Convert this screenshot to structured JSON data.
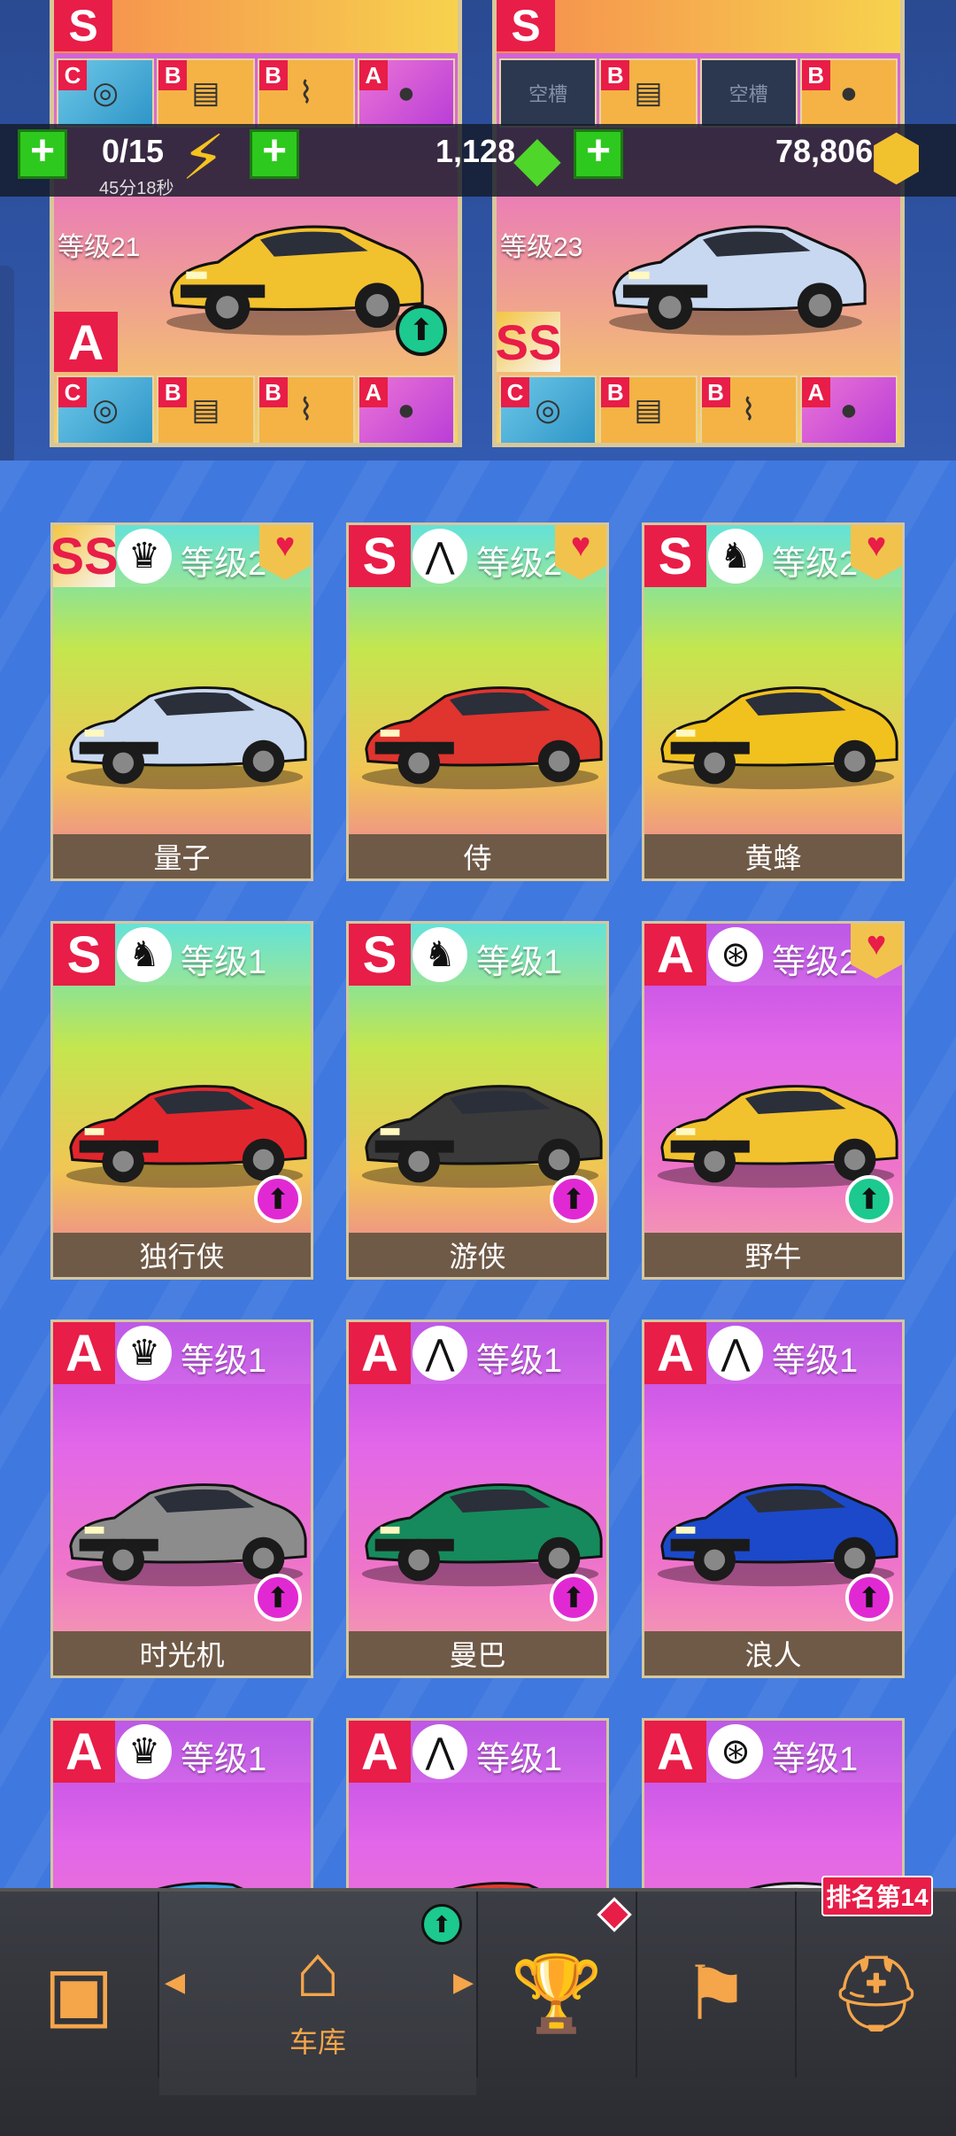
{
  "resources": {
    "energy": {
      "value": "0/15",
      "timer": "45分18秒",
      "icon": "lightning-bolt-icon"
    },
    "gems": {
      "value": "1,128",
      "icon": "green-gem-icon"
    },
    "coins": {
      "value": "78,806",
      "icon": "gold-hex-coin-icon"
    }
  },
  "featured_cars": [
    {
      "level": "等级21",
      "rank_top": "S",
      "rank": "A",
      "parts": [
        {
          "rank": "C",
          "icon": "turbo-icon"
        },
        {
          "rank": "B",
          "icon": "ecu-icon"
        },
        {
          "rank": "B",
          "icon": "shock-absorber-icon"
        },
        {
          "rank": "A",
          "icon": "tire-icon"
        }
      ],
      "parts_top": [
        {
          "rank": "C",
          "icon": "turbo-icon"
        },
        {
          "rank": "B",
          "icon": "ecu-icon"
        },
        {
          "rank": "B",
          "icon": "shock-absorber-icon"
        },
        {
          "rank": "A",
          "icon": "tire-icon"
        }
      ],
      "color": "#f2c12e"
    },
    {
      "level": "等级23",
      "rank_top": "S",
      "rank": "SS",
      "parts": [
        {
          "rank": "C",
          "icon": "turbo-icon"
        },
        {
          "rank": "B",
          "icon": "ecu-icon"
        },
        {
          "rank": "B",
          "icon": "shock-absorber-icon"
        },
        {
          "rank": "A",
          "icon": "tire-icon"
        }
      ],
      "parts_top": [
        {
          "rank": "",
          "label": "空槽"
        },
        {
          "rank": "B",
          "icon": "ecu-icon"
        },
        {
          "rank": "",
          "label": "空槽"
        },
        {
          "rank": "B",
          "icon": "tire-icon"
        }
      ],
      "color": "#c8d8f0"
    }
  ],
  "cars": [
    {
      "name": "量子",
      "rank": "SS",
      "level": "等级2",
      "class_icon": "crown-icon",
      "favorite": true,
      "upgrade": null,
      "color": "#c8d8f0"
    },
    {
      "name": "侍",
      "rank": "S",
      "level": "等级2",
      "class_icon": "road-icon",
      "favorite": true,
      "upgrade": null,
      "color": "#e0342e"
    },
    {
      "name": "黄蜂",
      "rank": "S",
      "level": "等级2",
      "class_icon": "horse-icon",
      "favorite": true,
      "upgrade": null,
      "color": "#f1c21e"
    },
    {
      "name": "独行侠",
      "rank": "S",
      "level": "等级1",
      "class_icon": "horse-icon",
      "favorite": false,
      "upgrade": "magenta",
      "color": "#e2262e"
    },
    {
      "name": "游侠",
      "rank": "S",
      "level": "等级1",
      "class_icon": "horse-icon",
      "favorite": false,
      "upgrade": "magenta",
      "color": "#3a3a3a"
    },
    {
      "name": "野牛",
      "rank": "A",
      "level": "等级2",
      "class_icon": "wheel-icon",
      "favorite": true,
      "upgrade": "green",
      "color": "#f2c12e"
    },
    {
      "name": "时光机",
      "rank": "A",
      "level": "等级1",
      "class_icon": "crown-icon",
      "favorite": false,
      "upgrade": "magenta",
      "color": "#8c8c8c"
    },
    {
      "name": "曼巴",
      "rank": "A",
      "level": "等级1",
      "class_icon": "road-icon",
      "favorite": false,
      "upgrade": "magenta",
      "color": "#168a5c"
    },
    {
      "name": "浪人",
      "rank": "A",
      "level": "等级1",
      "class_icon": "road-icon",
      "favorite": false,
      "upgrade": "magenta",
      "color": "#1c49c9"
    },
    {
      "name": "",
      "rank": "A",
      "level": "等级1",
      "class_icon": "crown-icon",
      "favorite": false,
      "upgrade": null,
      "color": "#3aa6e0"
    },
    {
      "name": "",
      "rank": "A",
      "level": "等级1",
      "class_icon": "road-icon",
      "favorite": false,
      "upgrade": null,
      "color": "#e53a2e"
    },
    {
      "name": "",
      "rank": "A",
      "level": "等级1",
      "class_icon": "wheel-icon",
      "favorite": false,
      "upgrade": null,
      "color": "#e8e8e8"
    }
  ],
  "nav": {
    "items": [
      {
        "name": "shop",
        "icon": "shop-box-icon",
        "label": ""
      },
      {
        "name": "garage",
        "icon": "garage-car-icon",
        "label": "车库"
      },
      {
        "name": "events",
        "icon": "trophy-flag-icon",
        "label": ""
      },
      {
        "name": "race",
        "icon": "checkered-flags-icon",
        "label": ""
      },
      {
        "name": "profile",
        "icon": "helmet-icon",
        "label": ""
      }
    ],
    "rank_badge": "排名第14"
  }
}
